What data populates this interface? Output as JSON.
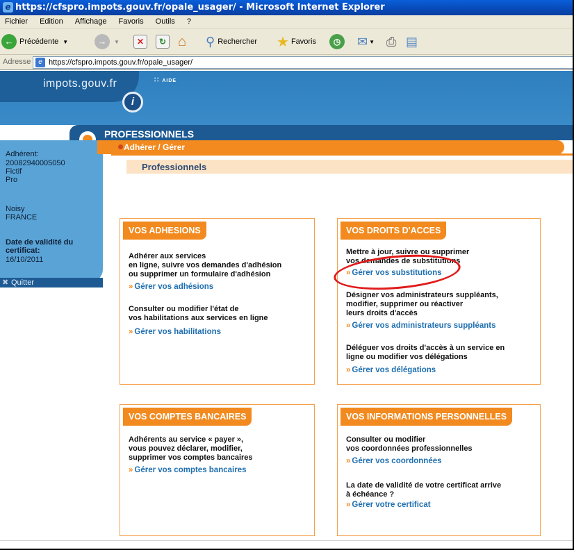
{
  "window": {
    "title": "https://cfspro.impots.gouv.fr/opale_usager/ - Microsoft Internet Explorer",
    "menu": [
      "Fichier",
      "Edition",
      "Affichage",
      "Favoris",
      "Outils",
      "?"
    ],
    "toolbar": {
      "back_label": "Précédente",
      "search_label": "Rechercher",
      "favorites_label": "Favoris"
    },
    "address": {
      "label": "Adresse",
      "url": "https://cfspro.impots.gouv.fr/opale_usager/"
    }
  },
  "site": {
    "logo": "impots.gouv.fr",
    "aide": "AIDE",
    "section": "PROFESSIONNELS",
    "breadcrumb": "Adhérer / Gérer",
    "page_title": "Professionnels"
  },
  "sidebar": {
    "label": "Adhérent:",
    "id": "20082940005050",
    "name1": "Fictif",
    "name2": "Pro",
    "city": "Noisy",
    "country": "FRANCE",
    "cert_label1": "Date de validité du",
    "cert_label2": "certificat:",
    "cert_date": "16/10/2011",
    "quit": "Quitter"
  },
  "boxes": {
    "adhesions": {
      "title": "VOS ADHESIONS",
      "d1": [
        "Adhérer aux services",
        "en ligne, suivre vos demandes d'adhésion",
        "ou supprimer un formulaire d'adhésion"
      ],
      "l1": "Gérer vos adhésions",
      "d2": [
        "Consulter ou modifier l'état de",
        "vos habilitations aux services en ligne"
      ],
      "l2": "Gérer vos habilitations"
    },
    "droits": {
      "title": "VOS DROITS D'ACCES",
      "d1": [
        "Mettre à jour, suivre ou supprimer",
        "vos demandes de substitutions"
      ],
      "l1": "Gérer vos substitutions",
      "d2": [
        "Désigner vos administrateurs suppléants,",
        "modifier, supprimer ou réactiver",
        "leurs droits d'accès"
      ],
      "l2": "Gérer vos administrateurs suppléants",
      "d3": [
        "Déléguer vos droits d'accès à un service en",
        "ligne ou modifier vos délégations"
      ],
      "l3": "Gérer vos délégations"
    },
    "comptes": {
      "title": "VOS COMPTES BANCAIRES",
      "d1": [
        "Adhérents au service « payer »,",
        "vous pouvez déclarer, modifier,",
        "supprimer vos comptes bancaires"
      ],
      "l1": "Gérer vos comptes bancaires"
    },
    "infos": {
      "title": "VOS INFORMATIONS PERSONNELLES",
      "d1": [
        "Consulter ou modifier",
        "vos coordonnées professionnelles"
      ],
      "l1": "Gérer vos coordonnées",
      "d2": [
        "La date de validité de votre certificat arrive",
        "à échéance ?"
      ],
      "l2": "Gérer votre certificat"
    }
  },
  "colors": {
    "orange": "#f28a1f",
    "blue_dark": "#1d5a93",
    "link": "#1f6fb0",
    "highlight": "#e01b1b"
  }
}
